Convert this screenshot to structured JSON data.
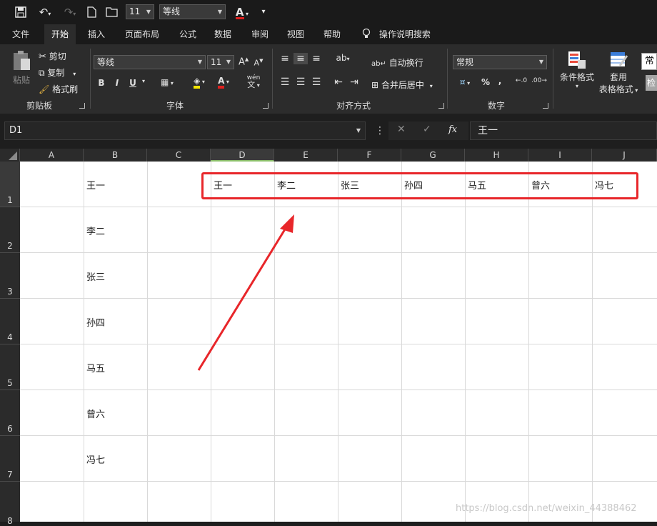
{
  "quick_access": {
    "font_size": "11",
    "font_name": "等线",
    "font_color_glyph": "A"
  },
  "tabs": [
    "文件",
    "开始",
    "插入",
    "页面布局",
    "公式",
    "数据",
    "审阅",
    "视图",
    "帮助",
    "操作说明搜索"
  ],
  "ribbon": {
    "clipboard": {
      "paste": "粘贴",
      "cut": "剪切",
      "copy": "复制",
      "format_painter": "格式刷",
      "label": "剪贴板"
    },
    "font": {
      "name": "等线",
      "size": "11",
      "bold": "B",
      "italic": "I",
      "underline": "U",
      "wen": "wén",
      "label": "字体"
    },
    "alignment": {
      "wrap_text": "自动换行",
      "merge_center": "合并后居中",
      "label": "对齐方式"
    },
    "number": {
      "format": "常规",
      "label": "数字"
    },
    "styles": {
      "conditional": "条件格式",
      "table_line1": "套用",
      "table_line2": "表格格式",
      "cell_style": "常",
      "check": "检"
    }
  },
  "formula_bar": {
    "name_box": "D1",
    "cancel": "✕",
    "enter": "✓",
    "fx": "fx",
    "content": "王一"
  },
  "columns": [
    "A",
    "B",
    "C",
    "D",
    "E",
    "F",
    "G",
    "H",
    "I",
    "J"
  ],
  "rows": [
    "1",
    "2",
    "3",
    "4",
    "5",
    "6",
    "7",
    "8"
  ],
  "column_b": [
    "王一",
    "李二",
    "张三",
    "孙四",
    "马五",
    "曾六",
    "冯七"
  ],
  "row1_transposed": [
    "王一",
    "李二",
    "张三",
    "孙四",
    "马五",
    "曾六",
    "冯七"
  ],
  "annotation": {
    "color": "#e8262a"
  },
  "watermark": "https://blog.csdn.net/weixin_44388462"
}
